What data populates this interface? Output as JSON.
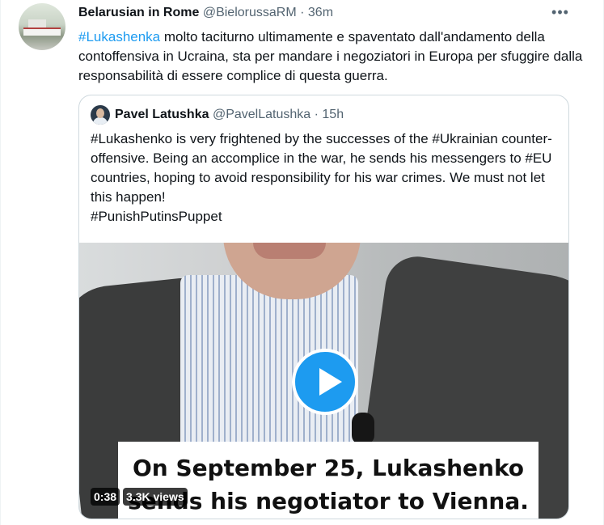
{
  "tweet": {
    "author_name": "Belarusian in Rome",
    "author_handle": "@BielorussaRM",
    "separator": "·",
    "time": "36m",
    "more_label": "•••",
    "text_hashtag": "#Lukashenka",
    "text_rest": " molto taciturno ultimamente e spaventato dall'andamento della contoffensiva in Ucraina, sta per mandare i negoziatori in Europa per sfuggire dalla responsabilità di essere complice di questa guerra."
  },
  "quoted": {
    "author_name": "Pavel Latushka",
    "author_handle": "@PavelLatushka",
    "separator": "·",
    "time": "15h",
    "text_line1": "#Lukashenko is very frightened by the successes of the #Ukrainian counter-offensive. Being an accomplice in the war, he sends his messengers to #EU countries, hoping to avoid responsibility for his war crimes. We must not let this happen!",
    "text_line2": "#PunishPutinsPuppet"
  },
  "video": {
    "caption_line1": "On September 25, Lukashenko",
    "caption_line2": "sends his negotiator to Vienna.",
    "duration": "0:38",
    "views": "3.3K views"
  }
}
